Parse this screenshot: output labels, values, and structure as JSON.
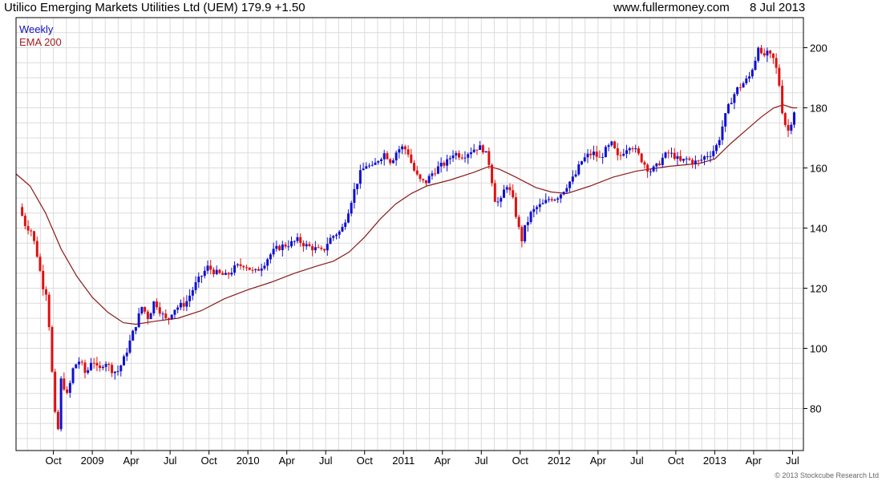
{
  "header": {
    "title": "Utilico Emerging Markets Utilities Ltd (UEM) 179.9 +1.50",
    "site": "www.fullermoney.com",
    "date": "8 Jul 2013"
  },
  "legend": {
    "weekly": "Weekly",
    "ema": "EMA 200"
  },
  "copyright": "© 2013 Stockcube Research Ltd",
  "colors": {
    "up": "#1010d0",
    "down": "#e01010",
    "ema": "#8b1a1a",
    "grid": "#dcdcdc",
    "legend_weekly": "#1010c0",
    "legend_ema": "#a02020"
  },
  "chart_data": {
    "type": "candlestick",
    "ylim": [
      66,
      210
    ],
    "y_ticks": [
      80,
      100,
      120,
      140,
      160,
      180,
      200
    ],
    "x_range": [
      2008.51,
      2013.57
    ],
    "x_ticks": [
      {
        "label": "Oct",
        "t": 2008.75
      },
      {
        "label": "2009",
        "t": 2009.0
      },
      {
        "label": "Apr",
        "t": 2009.25
      },
      {
        "label": "Jul",
        "t": 2009.5
      },
      {
        "label": "Oct",
        "t": 2009.75
      },
      {
        "label": "2010",
        "t": 2010.0
      },
      {
        "label": "Apr",
        "t": 2010.25
      },
      {
        "label": "Jul",
        "t": 2010.5
      },
      {
        "label": "Oct",
        "t": 2010.75
      },
      {
        "label": "2011",
        "t": 2011.0
      },
      {
        "label": "Apr",
        "t": 2011.25
      },
      {
        "label": "Jul",
        "t": 2011.5
      },
      {
        "label": "Oct",
        "t": 2011.75
      },
      {
        "label": "2012",
        "t": 2012.0
      },
      {
        "label": "Apr",
        "t": 2012.25
      },
      {
        "label": "Jul",
        "t": 2012.5
      },
      {
        "label": "Oct",
        "t": 2012.75
      },
      {
        "label": "2013",
        "t": 2013.0
      },
      {
        "label": "Apr",
        "t": 2013.25
      },
      {
        "label": "Jul",
        "t": 2013.5
      }
    ],
    "price_path": [
      [
        2008.53,
        147
      ],
      [
        2008.57,
        141
      ],
      [
        2008.61,
        139
      ],
      [
        2008.65,
        130
      ],
      [
        2008.68,
        121
      ],
      [
        2008.71,
        118
      ],
      [
        2008.74,
        93
      ],
      [
        2008.76,
        78
      ],
      [
        2008.78,
        73
      ],
      [
        2008.8,
        90
      ],
      [
        2008.84,
        84
      ],
      [
        2008.88,
        94
      ],
      [
        2008.92,
        96
      ],
      [
        2008.96,
        91
      ],
      [
        2009.0,
        97
      ],
      [
        2009.04,
        92
      ],
      [
        2009.08,
        96
      ],
      [
        2009.12,
        93
      ],
      [
        2009.16,
        92
      ],
      [
        2009.2,
        96
      ],
      [
        2009.24,
        102
      ],
      [
        2009.28,
        108
      ],
      [
        2009.32,
        114
      ],
      [
        2009.36,
        110
      ],
      [
        2009.4,
        116
      ],
      [
        2009.44,
        112
      ],
      [
        2009.48,
        109
      ],
      [
        2009.52,
        113
      ],
      [
        2009.56,
        114
      ],
      [
        2009.6,
        115
      ],
      [
        2009.66,
        121
      ],
      [
        2009.7,
        124
      ],
      [
        2009.74,
        127
      ],
      [
        2009.8,
        125
      ],
      [
        2009.86,
        124
      ],
      [
        2009.92,
        127
      ],
      [
        2009.98,
        128
      ],
      [
        2010.04,
        125
      ],
      [
        2010.1,
        128
      ],
      [
        2010.14,
        131
      ],
      [
        2010.18,
        133
      ],
      [
        2010.22,
        134
      ],
      [
        2010.28,
        135
      ],
      [
        2010.32,
        136
      ],
      [
        2010.38,
        134
      ],
      [
        2010.44,
        133
      ],
      [
        2010.48,
        132
      ],
      [
        2010.52,
        136
      ],
      [
        2010.56,
        138
      ],
      [
        2010.6,
        139
      ],
      [
        2010.64,
        145
      ],
      [
        2010.68,
        152
      ],
      [
        2010.72,
        158
      ],
      [
        2010.76,
        161
      ],
      [
        2010.8,
        160
      ],
      [
        2010.84,
        163
      ],
      [
        2010.88,
        165
      ],
      [
        2010.92,
        162
      ],
      [
        2010.96,
        166
      ],
      [
        2011.0,
        167
      ],
      [
        2011.03,
        165
      ],
      [
        2011.06,
        160
      ],
      [
        2011.1,
        156
      ],
      [
        2011.14,
        155
      ],
      [
        2011.18,
        158
      ],
      [
        2011.22,
        160
      ],
      [
        2011.28,
        162
      ],
      [
        2011.32,
        165
      ],
      [
        2011.38,
        164
      ],
      [
        2011.44,
        166
      ],
      [
        2011.48,
        167
      ],
      [
        2011.52,
        166
      ],
      [
        2011.56,
        160
      ],
      [
        2011.58,
        150
      ],
      [
        2011.62,
        148
      ],
      [
        2011.66,
        155
      ],
      [
        2011.7,
        150
      ],
      [
        2011.74,
        140
      ],
      [
        2011.76,
        136
      ],
      [
        2011.78,
        140
      ],
      [
        2011.82,
        145
      ],
      [
        2011.86,
        147
      ],
      [
        2011.9,
        148
      ],
      [
        2011.94,
        150
      ],
      [
        2011.98,
        150
      ],
      [
        2012.02,
        152
      ],
      [
        2012.06,
        155
      ],
      [
        2012.1,
        157
      ],
      [
        2012.14,
        162
      ],
      [
        2012.18,
        164
      ],
      [
        2012.22,
        165
      ],
      [
        2012.26,
        163
      ],
      [
        2012.3,
        166
      ],
      [
        2012.34,
        168
      ],
      [
        2012.38,
        163
      ],
      [
        2012.42,
        166
      ],
      [
        2012.46,
        168
      ],
      [
        2012.5,
        165
      ],
      [
        2012.54,
        162
      ],
      [
        2012.58,
        159
      ],
      [
        2012.62,
        160
      ],
      [
        2012.66,
        163
      ],
      [
        2012.7,
        165
      ],
      [
        2012.74,
        164
      ],
      [
        2012.78,
        162
      ],
      [
        2012.82,
        163
      ],
      [
        2012.86,
        162
      ],
      [
        2012.9,
        162
      ],
      [
        2012.94,
        164
      ],
      [
        2012.98,
        165
      ],
      [
        2013.02,
        168
      ],
      [
        2013.06,
        176
      ],
      [
        2013.1,
        182
      ],
      [
        2013.14,
        186
      ],
      [
        2013.18,
        188
      ],
      [
        2013.22,
        190
      ],
      [
        2013.26,
        196
      ],
      [
        2013.28,
        201
      ],
      [
        2013.3,
        197
      ],
      [
        2013.34,
        198
      ],
      [
        2013.38,
        196
      ],
      [
        2013.41,
        190
      ],
      [
        2013.43,
        180
      ],
      [
        2013.46,
        173
      ],
      [
        2013.48,
        172
      ],
      [
        2013.5,
        178
      ],
      [
        2013.52,
        179.9
      ]
    ],
    "ema_200": [
      [
        2008.51,
        158
      ],
      [
        2008.6,
        154
      ],
      [
        2008.7,
        145
      ],
      [
        2008.8,
        133
      ],
      [
        2008.9,
        124
      ],
      [
        2009.0,
        117
      ],
      [
        2009.1,
        112
      ],
      [
        2009.2,
        108.5
      ],
      [
        2009.28,
        108
      ],
      [
        2009.4,
        109
      ],
      [
        2009.55,
        110
      ],
      [
        2009.7,
        112.5
      ],
      [
        2009.85,
        116.5
      ],
      [
        2010.0,
        119.5
      ],
      [
        2010.15,
        122
      ],
      [
        2010.3,
        125
      ],
      [
        2010.45,
        127.5
      ],
      [
        2010.55,
        129
      ],
      [
        2010.65,
        132
      ],
      [
        2010.75,
        137
      ],
      [
        2010.85,
        143
      ],
      [
        2010.95,
        148
      ],
      [
        2011.05,
        151.5
      ],
      [
        2011.15,
        154
      ],
      [
        2011.3,
        156
      ],
      [
        2011.45,
        158.5
      ],
      [
        2011.55,
        160.5
      ],
      [
        2011.62,
        159.5
      ],
      [
        2011.72,
        157
      ],
      [
        2011.85,
        153.5
      ],
      [
        2011.95,
        152
      ],
      [
        2012.05,
        151.5
      ],
      [
        2012.2,
        154
      ],
      [
        2012.35,
        157
      ],
      [
        2012.5,
        159
      ],
      [
        2012.7,
        160.5
      ],
      [
        2012.9,
        161.5
      ],
      [
        2013.0,
        163
      ],
      [
        2013.1,
        168
      ],
      [
        2013.2,
        172.5
      ],
      [
        2013.3,
        177
      ],
      [
        2013.38,
        180
      ],
      [
        2013.44,
        181
      ],
      [
        2013.5,
        180
      ],
      [
        2013.53,
        180
      ]
    ]
  }
}
